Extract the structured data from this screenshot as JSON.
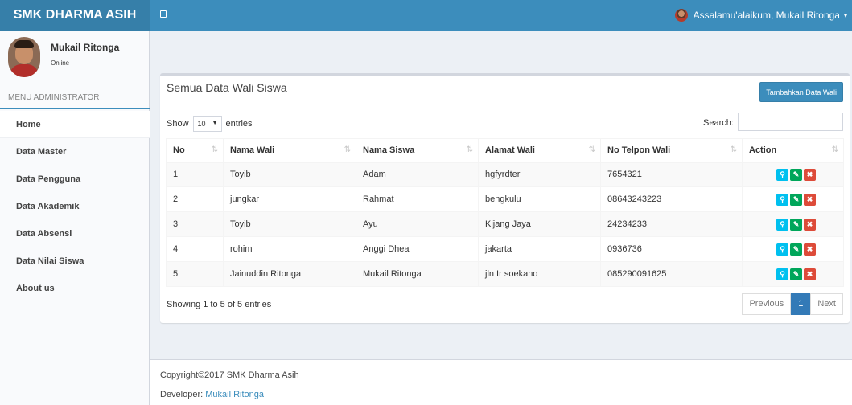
{
  "header": {
    "brand": "SMK DHARMA ASIH",
    "greeting": "Assalamu'alaikum, Mukail Ritonga",
    "caret": "▾"
  },
  "colors": {
    "primary": "#3c8dbc",
    "success": "#00a65a",
    "danger": "#dd4b39",
    "info": "#00c0ef"
  },
  "sidebar": {
    "user_name": "Mukail Ritonga",
    "status": "Online",
    "menu_header": "MENU ADMINISTRATOR",
    "items": [
      {
        "label": "Home"
      },
      {
        "label": "Data Master"
      },
      {
        "label": "Data Pengguna"
      },
      {
        "label": "Data Akademik"
      },
      {
        "label": "Data Absensi"
      },
      {
        "label": "Data Nilai Siswa"
      },
      {
        "label": "About us"
      }
    ]
  },
  "box": {
    "title": "Semua Data Wali Siswa",
    "add_button": "Tambahkan Data Wali"
  },
  "datatable": {
    "show_label": "Show",
    "page_length": "10",
    "entries_label": "entries",
    "search_label": "Search:",
    "search_value": "",
    "columns": [
      "No",
      "Nama Wali",
      "Nama Siswa",
      "Alamat Wali",
      "No Telpon Wali",
      "Action"
    ],
    "rows": [
      {
        "no": "1",
        "nama_wali": "Toyib",
        "nama_siswa": "Adam",
        "alamat": "hgfyrdter",
        "telpon": "7654321"
      },
      {
        "no": "2",
        "nama_wali": "jungkar",
        "nama_siswa": "Rahmat",
        "alamat": "bengkulu",
        "telpon": "08643243223"
      },
      {
        "no": "3",
        "nama_wali": "Toyib",
        "nama_siswa": "Ayu",
        "alamat": "Kijang Jaya",
        "telpon": "24234233"
      },
      {
        "no": "4",
        "nama_wali": "rohim",
        "nama_siswa": "Anggi Dhea",
        "alamat": "jakarta",
        "telpon": "0936736"
      },
      {
        "no": "5",
        "nama_wali": "Jainuddin Ritonga",
        "nama_siswa": "Mukail Ritonga",
        "alamat": "jln Ir soekano",
        "telpon": "085290091625"
      }
    ],
    "action_icons": [
      "search-icon",
      "edit-icon",
      "delete-icon"
    ],
    "info": "Showing 1 to 5 of 5 entries",
    "pagination": {
      "previous": "Previous",
      "current": "1",
      "next": "Next"
    }
  },
  "footer": {
    "copyright": "Copyright©2017 SMK Dharma Asih",
    "developer_label": "Developer:",
    "developer_name": "Mukail Ritonga"
  }
}
